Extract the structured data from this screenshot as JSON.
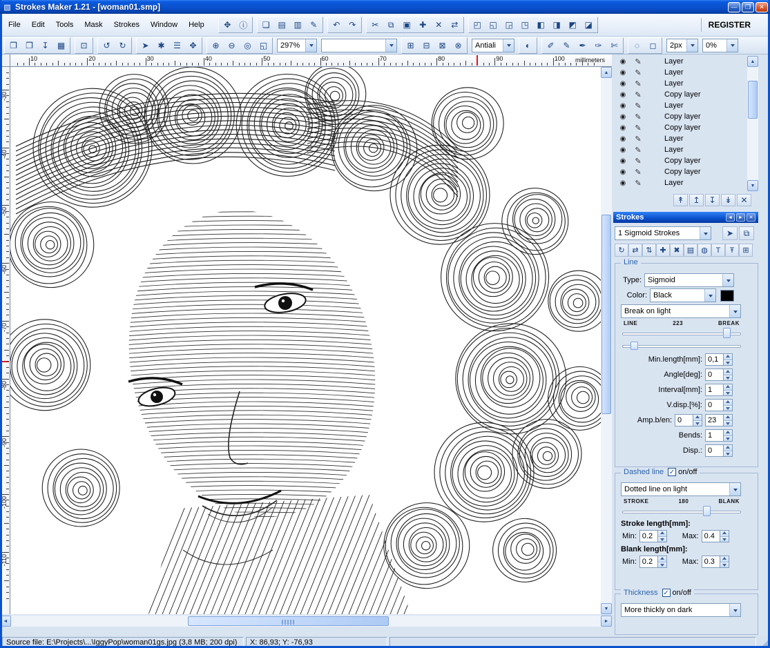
{
  "window": {
    "title": "Strokes Maker 1.21 - [woman01.smp]",
    "minimize_glyph": "—",
    "maximize_glyph": "❐",
    "close_glyph": "✕"
  },
  "menus": [
    "File",
    "Edit",
    "Tools",
    "Mask",
    "Strokes",
    "Window",
    "Help"
  ],
  "register_label": "REGISTER",
  "toolbar": {
    "zoom": "297%",
    "preset_combo": "",
    "antialias": "Antiali",
    "pen_size": "2px",
    "opacity": "0%"
  },
  "ruler": {
    "h_labels": [
      "10",
      "20",
      "30",
      "40",
      "50",
      "60",
      "70",
      "80",
      "90",
      "100"
    ],
    "v_labels": [
      "-30",
      "-40",
      "-50",
      "-60",
      "-70",
      "-80",
      "-90",
      "-100",
      "-110"
    ],
    "unit": "millimeters"
  },
  "layers": {
    "items": [
      "Layer",
      "Layer",
      "Layer",
      "Copy layer",
      "Layer",
      "Copy layer",
      "Copy layer",
      "Layer",
      "Layer",
      "Copy layer",
      "Copy layer",
      "Layer"
    ]
  },
  "strokes_panel": {
    "title": "Strokes",
    "preset": "1 Sigmoid Strokes",
    "line": {
      "title": "Line",
      "type_label": "Type:",
      "type": "Sigmoid",
      "color_label": "Color:",
      "color": "Black",
      "color_hex": "#000000",
      "mode": "Break on light",
      "slider_left": "LINE",
      "slider_value": "223",
      "slider_right": "BREAK",
      "min_length_label": "Min.length[mm]:",
      "min_length": "0,1",
      "angle_label": "Angle[deg]:",
      "angle": "0",
      "interval_label": "Interval[mm]:",
      "interval": "1",
      "vdisp_label": "V.disp.[%]:",
      "vdisp": "0",
      "amp_label": "Amp.b/en:",
      "amp1": "0",
      "amp2": "23",
      "bends_label": "Bends:",
      "bends": "1",
      "disp_label": "Disp.:",
      "disp": "0"
    },
    "dashed": {
      "title": "Dashed line",
      "onoff": "on/off",
      "mode": "Dotted line on light",
      "slider_left": "STROKE",
      "slider_value": "180",
      "slider_right": "BLANK",
      "stroke_header": "Stroke length[mm]:",
      "min_label": "Min:",
      "max_label": "Max:",
      "stroke_min": "0.2",
      "stroke_max": "0.4",
      "blank_header": "Blank length[mm]:",
      "blank_min": "0.2",
      "blank_max": "0.3"
    },
    "thickness": {
      "title": "Thickness",
      "onoff": "on/off",
      "mode": "More thickly on dark"
    }
  },
  "status": {
    "source": "Source file: E:\\Projects\\...\\IggyPop\\woman01gs.jpg (3,8 MB; 200 dpi)",
    "coords": "X: 86,93; Y: -76,93"
  },
  "colors": {
    "titlebar": "#0a52cf",
    "accent": "#2b63ad",
    "ruler_marker": "#e81123"
  },
  "icons": {
    "app": "▧",
    "hand_tool": "✥",
    "info": "ⓘ",
    "cascade": "❏",
    "tile_h": "▤",
    "tile_v": "▥",
    "edit_pencil": "✎",
    "undo": "↶",
    "redo": "↷",
    "cut": "✂",
    "copy": "⧉",
    "paste": "▣",
    "duplicate": "✚",
    "erase": "✕",
    "swap": "⇄",
    "mask_a": "◰",
    "mask_b": "◱",
    "mask_c": "◲",
    "mask_d": "◳",
    "mask_e": "◧",
    "mask_f": "◨",
    "mask_g": "◩",
    "mask_h": "◪",
    "new_file": "❐",
    "open": "❒",
    "import": "↧",
    "save": "▦",
    "acquire": "⊡",
    "rotate_left": "↺",
    "rotate_right": "↻",
    "select": "➤",
    "wand": "✱",
    "rows": "☰",
    "pan": "✥",
    "zoom_in": "⊕",
    "zoom_out": "⊖",
    "zoom_100": "◎",
    "zoom_fit": "◱",
    "mask_add": "⊞",
    "mask_sub": "⊟",
    "mask_mul": "⊠",
    "mask_xor": "⊗",
    "smooth": "◐",
    "pipette": "✐",
    "pen": "✎",
    "nib": "✒",
    "brush": "✑",
    "knife": "✄",
    "lasso": "◌",
    "crop": "◻",
    "preset_apply": "➤",
    "preset_copy": "⧉",
    "sr_regen": "↻",
    "sr_swap": "⇄",
    "sr_updown": "⇅",
    "sr_add": "✚",
    "sr_del": "✖",
    "sr_props": "▤",
    "sr_preview": "◍",
    "sr_text": "T",
    "sr_text2": "Ŧ",
    "sr_grid": "⊞",
    "eye": "◉",
    "pencil": "✎",
    "layer_top": "↟",
    "layer_up": "↥",
    "layer_down": "↧",
    "layer_bottom": "↡",
    "layer_delete": "✕",
    "left": "◄",
    "right": "►",
    "up": "▲",
    "down": "▼",
    "close_x": "✕",
    "check": "✓"
  }
}
